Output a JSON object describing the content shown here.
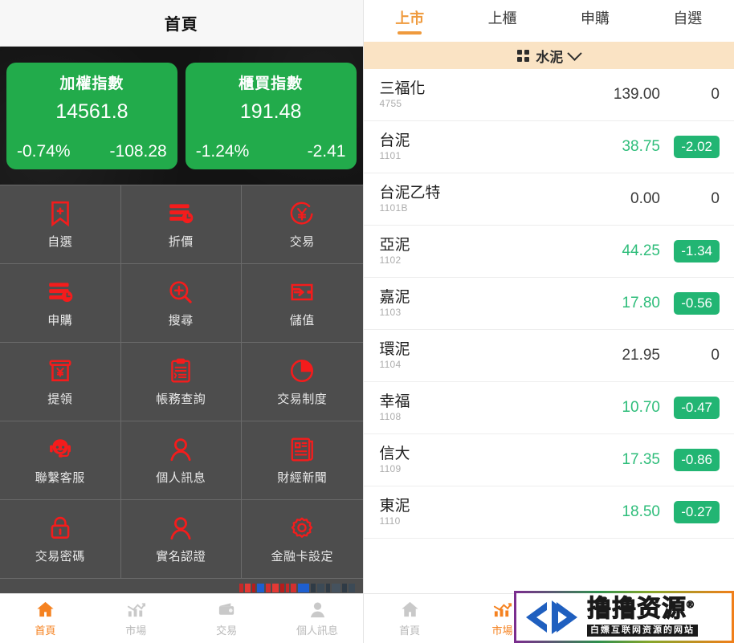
{
  "left_panel": {
    "header": {
      "title": "首頁"
    },
    "indices": [
      {
        "name": "加權指數",
        "value": "14561.8",
        "percent": "-0.74%",
        "change": "-108.28",
        "color": "#22ab4b"
      },
      {
        "name": "櫃買指數",
        "value": "191.48",
        "percent": "-1.24%",
        "change": "-2.41",
        "color": "#22ab4b"
      }
    ],
    "menu_grid": [
      {
        "label": "自選",
        "icon": "bookmark-plus-icon"
      },
      {
        "label": "折價",
        "icon": "discount-clock-icon"
      },
      {
        "label": "交易",
        "icon": "yen-circle-icon"
      },
      {
        "label": "申購",
        "icon": "subscribe-clock-icon"
      },
      {
        "label": "搜尋",
        "icon": "search-plus-icon"
      },
      {
        "label": "儲值",
        "icon": "wallet-deposit-icon"
      },
      {
        "label": "提領",
        "icon": "atm-withdraw-icon"
      },
      {
        "label": "帳務查詢",
        "icon": "clipboard-report-icon"
      },
      {
        "label": "交易制度",
        "icon": "pie-chart-icon"
      },
      {
        "label": "聯繫客服",
        "icon": "headset-support-icon"
      },
      {
        "label": "個人訊息",
        "icon": "user-icon"
      },
      {
        "label": "財經新聞",
        "icon": "newspaper-icon"
      },
      {
        "label": "交易密碼",
        "icon": "lock-icon"
      },
      {
        "label": "實名認證",
        "icon": "user-verify-icon"
      },
      {
        "label": "金融卡設定",
        "icon": "gear-icon"
      }
    ],
    "icon_color": "#f41c1c",
    "bottom_nav": {
      "active": "首頁",
      "items": [
        {
          "label": "首頁",
          "icon": "home-icon"
        },
        {
          "label": "市場",
          "icon": "chart-bars-icon"
        },
        {
          "label": "交易",
          "icon": "wallet-icon"
        },
        {
          "label": "個人訊息",
          "icon": "user-icon"
        }
      ]
    }
  },
  "right_panel": {
    "tabs": [
      {
        "label": "上市",
        "active": true
      },
      {
        "label": "上櫃",
        "active": false
      },
      {
        "label": "申購",
        "active": false
      },
      {
        "label": "自選",
        "active": false
      }
    ],
    "category": {
      "label": "水泥",
      "grid_icon": "grid-icon",
      "chevron": "chevron-down-icon"
    },
    "stocks": [
      {
        "name": "三福化",
        "code": "4755",
        "price": "139.00",
        "change": "0",
        "badge": false
      },
      {
        "name": "台泥",
        "code": "1101",
        "price": "38.75",
        "change": "-2.02",
        "badge": true
      },
      {
        "name": "台泥乙特",
        "code": "1101B",
        "price": "0.00",
        "change": "0",
        "badge": false
      },
      {
        "name": "亞泥",
        "code": "1102",
        "price": "44.25",
        "change": "-1.34",
        "badge": true
      },
      {
        "name": "嘉泥",
        "code": "1103",
        "price": "17.80",
        "change": "-0.56",
        "badge": true
      },
      {
        "name": "環泥",
        "code": "1104",
        "price": "21.95",
        "change": "0",
        "badge": false
      },
      {
        "name": "幸福",
        "code": "1108",
        "price": "10.70",
        "change": "-0.47",
        "badge": true
      },
      {
        "name": "信大",
        "code": "1109",
        "price": "17.35",
        "change": "-0.86",
        "badge": true
      },
      {
        "name": "東泥",
        "code": "1110",
        "price": "18.50",
        "change": "-0.27",
        "badge": true
      }
    ],
    "bottom_nav": {
      "active": "市場",
      "items": [
        {
          "label": "首頁",
          "icon": "home-icon"
        },
        {
          "label": "市場",
          "icon": "chart-bars-icon"
        }
      ]
    },
    "accent_color": "#ef9a3d",
    "down_color": "#22b573"
  },
  "watermark": {
    "title": "撸撸资源",
    "registered": "®",
    "subtitle": "白嫖互联网资源的网站"
  }
}
